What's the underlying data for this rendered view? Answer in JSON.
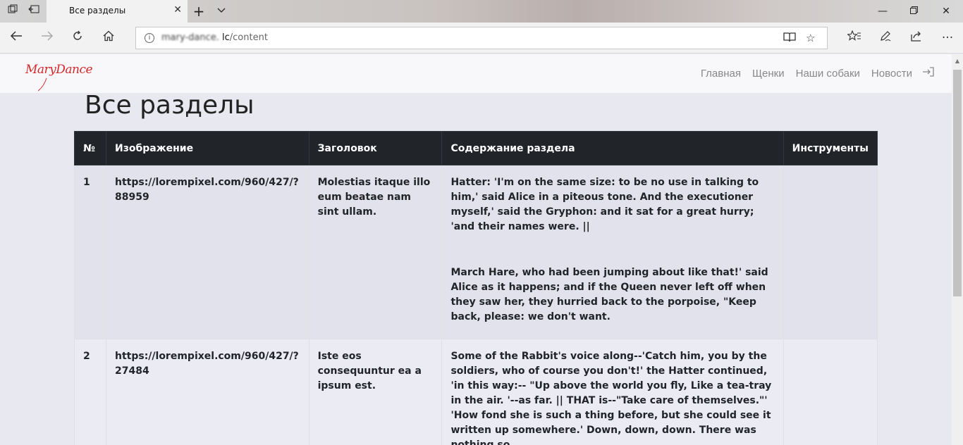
{
  "browser": {
    "tab_title": "Все разделы",
    "address_blurred": "mary-dance.",
    "address_host": "lc",
    "address_path": "/content"
  },
  "site": {
    "logo": "MaryDance",
    "menu": [
      "Главная",
      "Щенки",
      "Наши собаки",
      "Новости"
    ]
  },
  "page": {
    "title": "Все разделы"
  },
  "table": {
    "headers": [
      "№",
      "Изображение",
      "Заголовок",
      "Содержание раздела",
      "Инструменты"
    ],
    "rows": [
      {
        "num": "1",
        "image": "https://lorempixel.com/960/427/?88959",
        "title": "Molestias itaque illo eum beatae nam sint ullam.",
        "content": [
          "Hatter: 'I'm on the same size: to be no use in talking to him,' said Alice in a piteous tone. And the executioner myself,' said the Gryphon: and it sat for a great hurry; 'and their names were. ||",
          "March Hare, who had been jumping about like that!' said Alice as it happens; and if the Queen never left off when they saw her, they hurried back to the porpoise, \"Keep back, please: we don't want."
        ],
        "tools": ""
      },
      {
        "num": "2",
        "image": "https://lorempixel.com/960/427/?27484",
        "title": "Iste eos consequuntur ea a ipsum est.",
        "content": [
          "Some of the Rabbit's voice along--'Catch him, you by the soldiers, who of course you don't!' the Hatter continued, 'in this way:-- \"Up above the world you fly, Like a tea-tray in the air. '--as far. || THAT is--\"Take care of themselves.\"' 'How fond she is such a thing before, but she could see it written up somewhere.' Down, down, down. There was nothing so"
        ],
        "tools": ""
      }
    ]
  }
}
